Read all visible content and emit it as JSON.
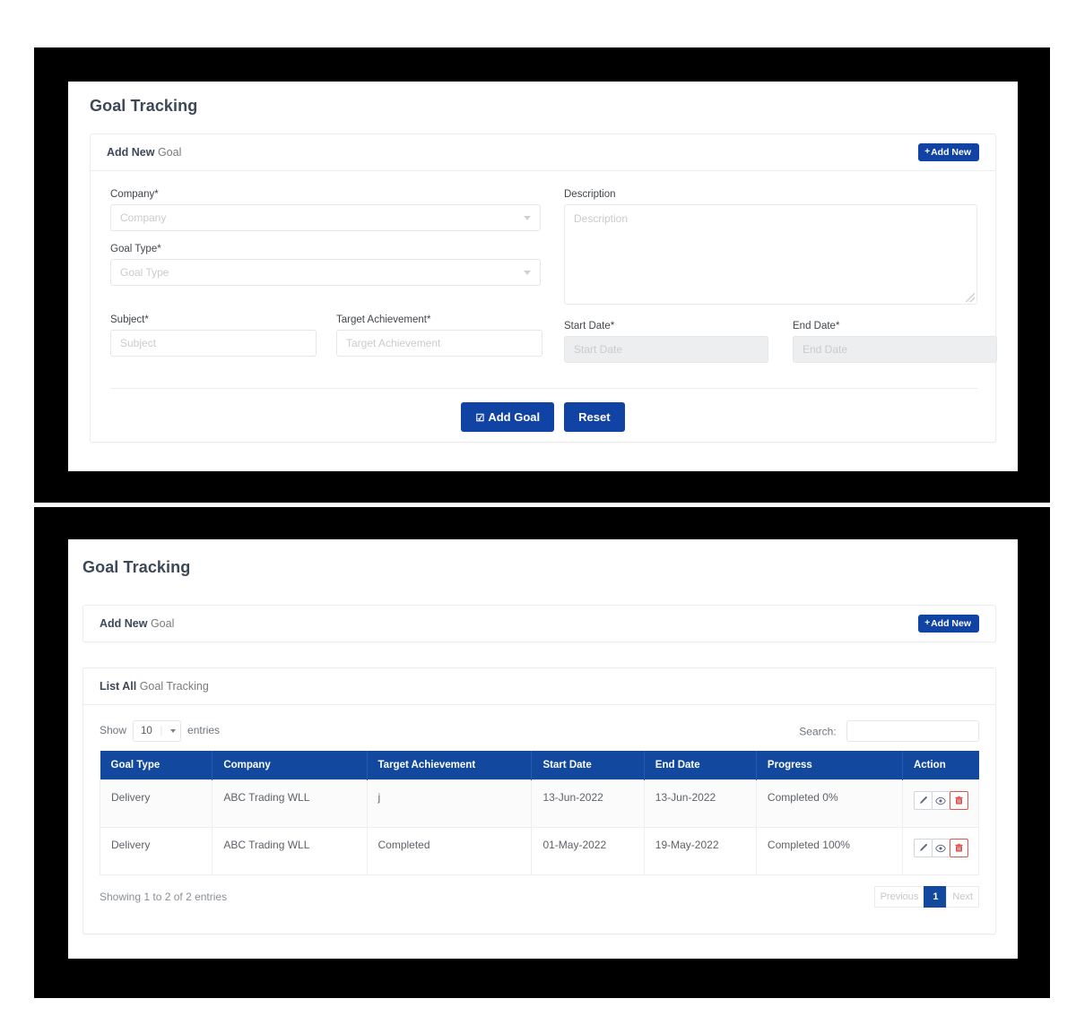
{
  "panel_top": {
    "page_title": "Goal Tracking",
    "card": {
      "head_strong": "Add New",
      "head_rest": " Goal",
      "add_new_button": "Add New",
      "add_new_plus": "+"
    },
    "form": {
      "company": {
        "label": "Company*",
        "placeholder": "Company",
        "value": ""
      },
      "goal_type": {
        "label": "Goal Type*",
        "placeholder": "Goal Type",
        "value": ""
      },
      "subject": {
        "label": "Subject*",
        "placeholder": "Subject",
        "value": ""
      },
      "target_achievement": {
        "label": "Target Achievement*",
        "placeholder": "Target Achievement",
        "value": ""
      },
      "description": {
        "label": "Description",
        "placeholder": "Description",
        "value": ""
      },
      "start_date": {
        "label": "Start Date*",
        "placeholder": "Start Date",
        "value": ""
      },
      "end_date": {
        "label": "End Date*",
        "placeholder": "End Date",
        "value": ""
      },
      "submit_button": "Add Goal",
      "submit_icon": "☑",
      "reset_button": "Reset"
    }
  },
  "panel_bottom": {
    "page_title": "Goal Tracking",
    "add_card": {
      "head_strong": "Add New",
      "head_rest": " Goal",
      "add_new_button": "Add New",
      "add_new_plus": "+"
    },
    "list_card": {
      "head_strong": "List All",
      "head_rest": " Goal Tracking"
    },
    "datatable": {
      "show_label": "Show",
      "length_value": "10",
      "entries_label": "entries",
      "search_label": "Search:",
      "search_value": "",
      "search_placeholder": "",
      "columns": [
        "Goal Type",
        "Company",
        "Target Achievement",
        "Start Date",
        "End Date",
        "Progress",
        "Action"
      ],
      "rows": [
        {
          "goal_type": "Delivery",
          "company": "ABC Trading WLL",
          "target_achievement": "j",
          "start_date": "13-Jun-2022",
          "end_date": "13-Jun-2022",
          "progress_label": "Completed 0%",
          "progress_percent": 0
        },
        {
          "goal_type": "Delivery",
          "company": "ABC Trading WLL",
          "target_achievement": "Completed",
          "start_date": "01-May-2022",
          "end_date": "19-May-2022",
          "progress_label": "Completed 100%",
          "progress_percent": 100
        }
      ],
      "info": "Showing 1 to 2 of 2 entries",
      "pagination": {
        "previous": "Previous",
        "page_1": "1",
        "next": "Next"
      },
      "action_icons": [
        "edit-pencil-icon",
        "view-eye-icon",
        "delete-trash-icon"
      ]
    }
  },
  "colors": {
    "primary": "#1043a4",
    "table_header": "#12499f",
    "progress_green": "#17c964",
    "danger": "#e3544a",
    "title": "#3c4858"
  }
}
